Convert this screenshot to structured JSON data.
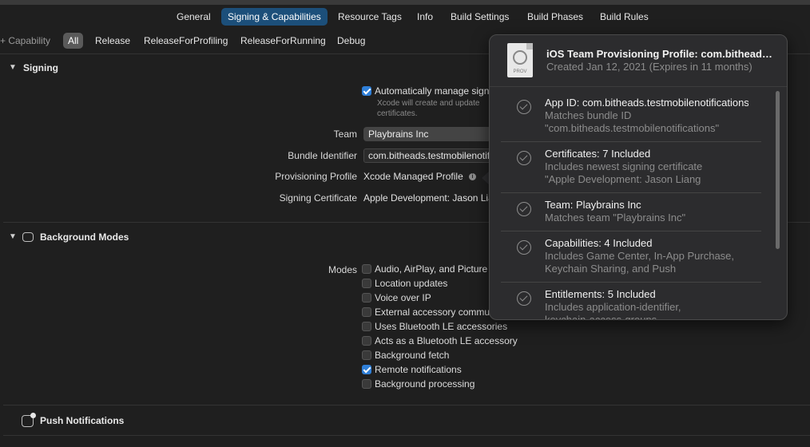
{
  "tabs": [
    "General",
    "Signing & Capabilities",
    "Resource Tags",
    "Info",
    "Build Settings",
    "Build Phases",
    "Build Rules"
  ],
  "active_tab": "Signing & Capabilities",
  "filter": {
    "capability_label": "+ Capability",
    "items": [
      "All",
      "Release",
      "ReleaseForProfiling",
      "ReleaseForRunning",
      "Debug"
    ],
    "active": "All"
  },
  "signing": {
    "title": "Signing",
    "auto_manage_label": "Automatically manage sign",
    "auto_manage_checked": true,
    "auto_manage_note_line1": "Xcode will create and update",
    "auto_manage_note_line2": "certificates.",
    "team_label": "Team",
    "team_value": "Playbrains Inc",
    "bundle_label": "Bundle Identifier",
    "bundle_value": "com.bitheads.testmobilenotifi",
    "profile_label": "Provisioning Profile",
    "profile_value": "Xcode Managed Profile",
    "cert_label": "Signing Certificate",
    "cert_value": "Apple Development: Jason Lia"
  },
  "background_modes": {
    "title": "Background Modes",
    "modes_label": "Modes",
    "items": [
      {
        "label": "Audio, AirPlay, and Picture",
        "checked": false
      },
      {
        "label": "Location updates",
        "checked": false
      },
      {
        "label": "Voice over IP",
        "checked": false
      },
      {
        "label": "External accessory commu",
        "checked": false
      },
      {
        "label": "Uses Bluetooth LE accessories",
        "checked": false
      },
      {
        "label": "Acts as a Bluetooth LE accessory",
        "checked": false
      },
      {
        "label": "Background fetch",
        "checked": false
      },
      {
        "label": "Remote notifications",
        "checked": true
      },
      {
        "label": "Background processing",
        "checked": false
      }
    ]
  },
  "push": {
    "title": "Push Notifications"
  },
  "popover": {
    "icon_text": "PROV",
    "title": "iOS Team Provisioning Profile: com.bitheads.testmobilenotifications",
    "subtitle": "Created Jan 12, 2021 (Expires in 11 months)",
    "items": [
      {
        "title": "App ID: com.bitheads.testmobilenotifications",
        "desc1": "Matches bundle ID",
        "desc2": "\"com.bitheads.testmobilenotifications\""
      },
      {
        "title": "Certificates: 7 Included",
        "desc1": "Includes newest signing certificate",
        "desc2": "\"Apple Development: Jason Liang"
      },
      {
        "title": "Team: Playbrains Inc",
        "desc1": "Matches team \"Playbrains Inc\"",
        "desc2": ""
      },
      {
        "title": "Capabilities: 4 Included",
        "desc1": "Includes Game Center, In-App Purchase,",
        "desc2": "Keychain Sharing, and Push"
      },
      {
        "title": "Entitlements: 5 Included",
        "desc1": "Includes application-identifier,",
        "desc2": "keychain-access-groups,"
      }
    ]
  }
}
